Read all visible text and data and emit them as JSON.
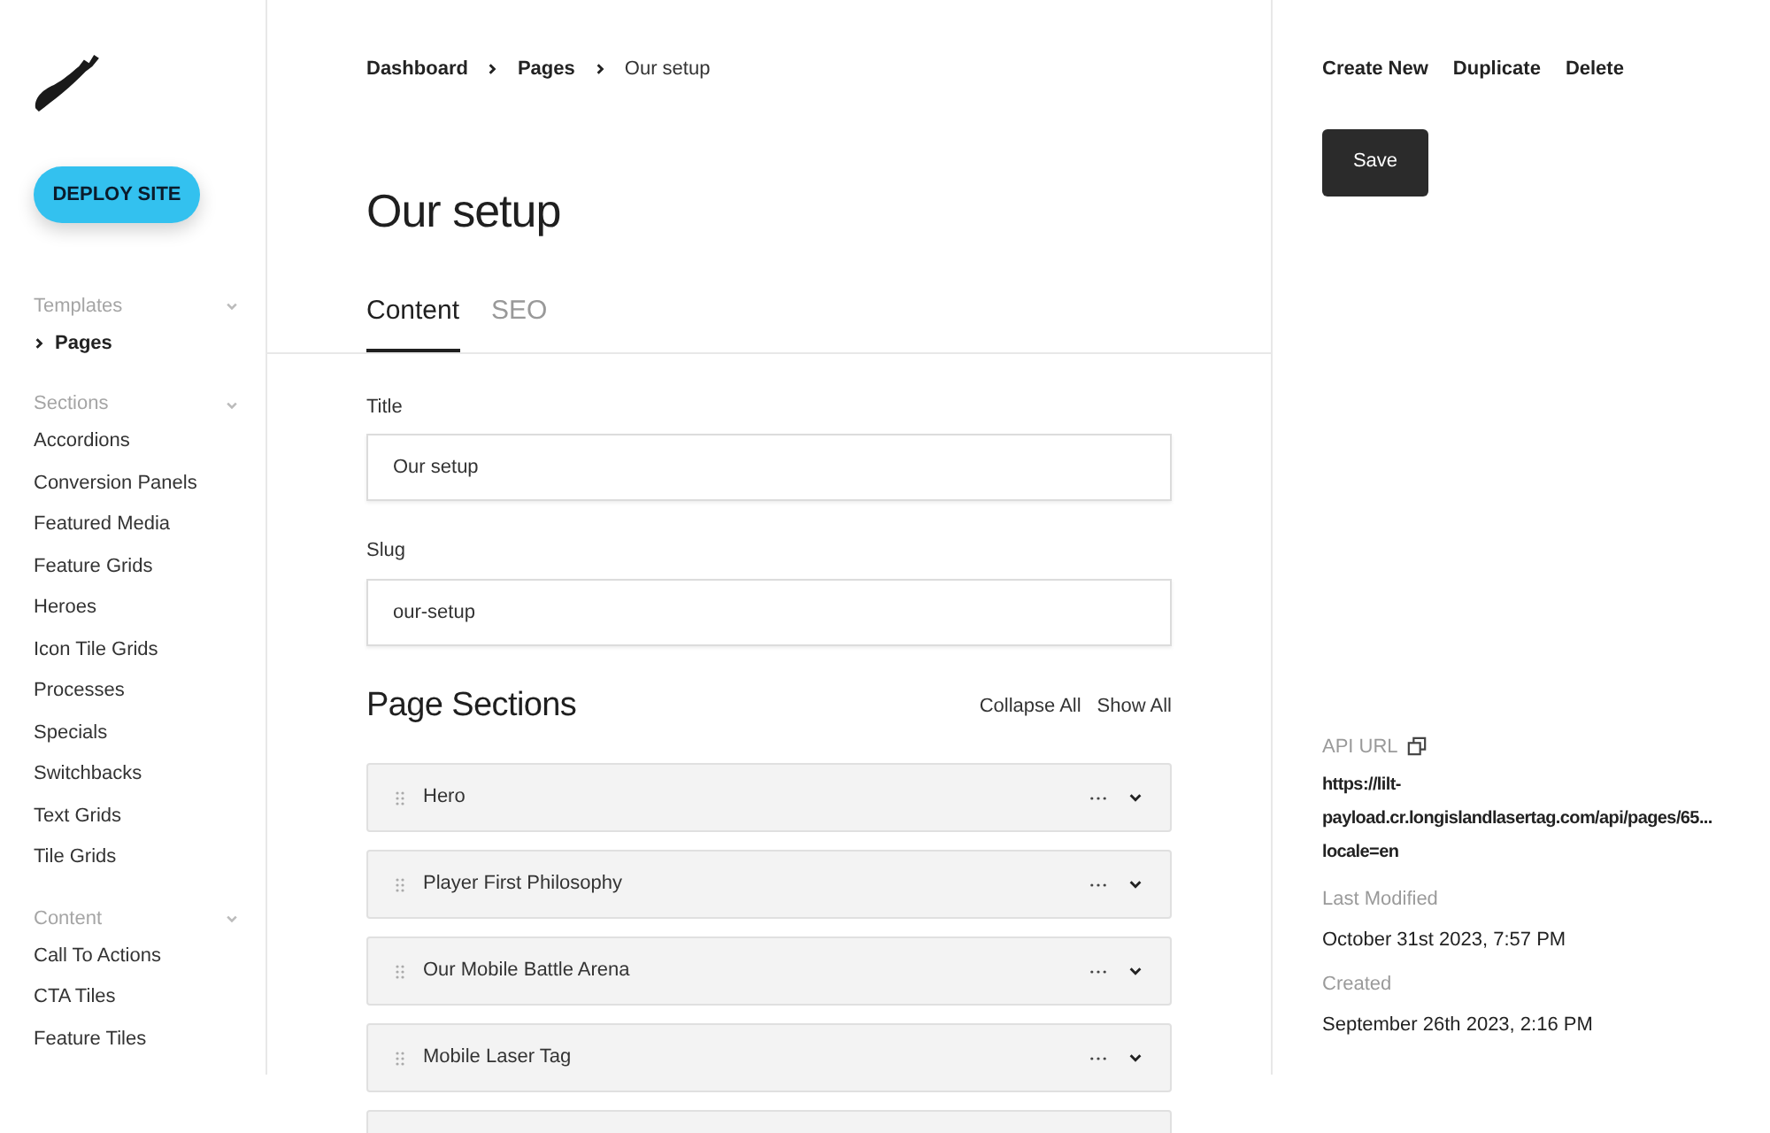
{
  "sidebar": {
    "deploy_button": "DEPLOY SITE",
    "groups": [
      {
        "label": "Templates",
        "expanded": true,
        "items": [
          {
            "label": "Pages",
            "selected": true
          }
        ]
      },
      {
        "label": "Sections",
        "expanded": true,
        "items": [
          {
            "label": "Accordions",
            "selected": false
          },
          {
            "label": "Conversion Panels",
            "selected": false
          },
          {
            "label": "Featured Media",
            "selected": false
          },
          {
            "label": "Feature Grids",
            "selected": false
          },
          {
            "label": "Heroes",
            "selected": false
          },
          {
            "label": "Icon Tile Grids",
            "selected": false
          },
          {
            "label": "Processes",
            "selected": false
          },
          {
            "label": "Specials",
            "selected": false
          },
          {
            "label": "Switchbacks",
            "selected": false
          },
          {
            "label": "Text Grids",
            "selected": false
          },
          {
            "label": "Tile Grids",
            "selected": false
          }
        ]
      },
      {
        "label": "Content",
        "expanded": true,
        "items": [
          {
            "label": "Call To Actions",
            "selected": false
          },
          {
            "label": "CTA Tiles",
            "selected": false
          },
          {
            "label": "Feature Tiles",
            "selected": false
          }
        ]
      }
    ]
  },
  "breadcrumb": [
    "Dashboard",
    "Pages",
    "Our setup"
  ],
  "title": "Our setup",
  "tabs": [
    {
      "label": "Content",
      "selected": true
    },
    {
      "label": "SEO",
      "selected": false
    }
  ],
  "fields": [
    {
      "label": "Title",
      "value": "Our setup"
    },
    {
      "label": "Slug",
      "value": "our-setup"
    }
  ],
  "page_sections": {
    "heading": "Page Sections",
    "actions": [
      "Collapse All",
      "Show All"
    ],
    "items": [
      {
        "kind": "section",
        "label": "Hero"
      },
      {
        "kind": "section",
        "label": "Player First Philosophy"
      },
      {
        "kind": "section",
        "label": "Our Mobile Battle Arena"
      },
      {
        "kind": "section",
        "label": "Mobile Laser Tag"
      },
      {
        "kind": "cut"
      }
    ]
  },
  "actions": [
    "Create New",
    "Duplicate",
    "Delete"
  ],
  "save_button": "Save",
  "meta": {
    "api_url_label": "API URL",
    "api_url_lines": [
      "https://lilt-",
      "payload.cr.longislandlasertag.com/api/pages/65...",
      "locale=en"
    ],
    "entries": [
      {
        "label": "Last Modified",
        "value": "October 31st 2023, 7:57 PM"
      },
      {
        "label": "Created",
        "value": "September 26th 2023, 2:16 PM"
      }
    ]
  }
}
